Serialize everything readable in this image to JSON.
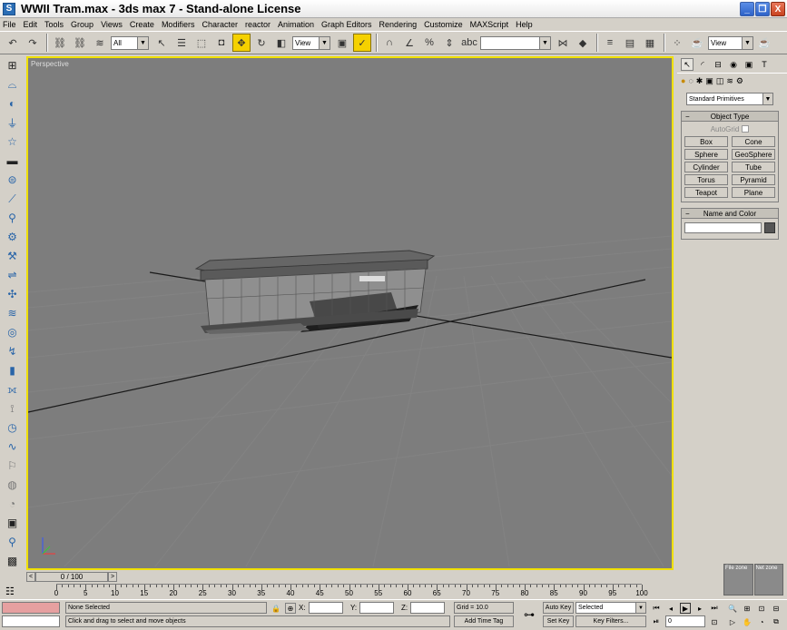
{
  "window": {
    "title": "WWII Tram.max - 3ds max 7  - Stand-alone License",
    "app_icon": "3ds-max-icon",
    "minimize": "_",
    "maximize": "❐",
    "close": "X"
  },
  "menu": [
    "File",
    "Edit",
    "Tools",
    "Group",
    "Views",
    "Create",
    "Modifiers",
    "Character",
    "reactor",
    "Animation",
    "Graph Editors",
    "Rendering",
    "Customize",
    "MAXScript",
    "Help"
  ],
  "toolbar": {
    "selection_filter": "All",
    "ref_coord": "View",
    "named_sel": "",
    "view_right": "View"
  },
  "viewport": {
    "label": "Perspective",
    "background": "#7d7d7d",
    "active_border": "#f0e000"
  },
  "command_panel": {
    "dropdown": "Standard Primitives",
    "object_type_title": "Object Type",
    "autogrid_label": "AutoGrid",
    "objects": [
      "Box",
      "Cone",
      "Sphere",
      "GeoSphere",
      "Cylinder",
      "Tube",
      "Torus",
      "Pyramid",
      "Teapot",
      "Plane"
    ],
    "name_color_title": "Name and Color",
    "name_value": "",
    "color": "#555555",
    "rollout_toggle": "−"
  },
  "zones": {
    "file_zone": "File zone",
    "net_zone": "Net zone"
  },
  "time_slider": {
    "label": "0 / 100",
    "prev": "<",
    "next": ">"
  },
  "track_ruler": {
    "ticks": [
      0,
      5,
      10,
      15,
      20,
      25,
      30,
      35,
      40,
      45,
      50,
      55,
      60,
      65,
      70,
      75,
      80,
      85,
      90,
      95,
      100
    ]
  },
  "status": {
    "selection_info": "None Selected",
    "prompt": "Click and drag to select and move objects",
    "x_label": "X:",
    "y_label": "Y:",
    "z_label": "Z:",
    "x_value": "",
    "y_value": "",
    "z_value": "",
    "grid": "Grid = 10.0",
    "add_time_tag": "Add Time Tag",
    "auto_key": "Auto Key",
    "set_key": "Set Key",
    "selected": "Selected",
    "key_filters": "Key Filters...",
    "frame": "0"
  }
}
